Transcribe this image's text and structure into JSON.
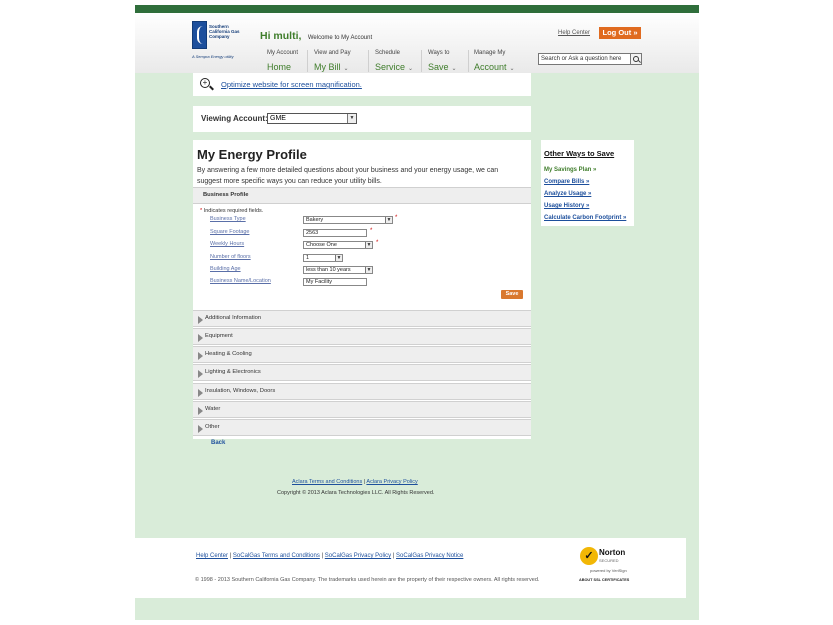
{
  "colors": {
    "brand_green": "#2f6e3b",
    "page_bg": "#d9ecd9",
    "link_blue": "#1d4f9c",
    "logout_orange": "#e06b20"
  },
  "logo": {
    "name": "Southern California Gas Company",
    "tagline": "A Sempra Energy utility"
  },
  "header": {
    "greeting": "Hi multi,",
    "welcome": "Welcome to My Account",
    "help_center": "Help Center",
    "logout": "Log Out »",
    "search_placeholder": "Search or Ask a question here",
    "nav": [
      {
        "small": "My Account",
        "large": "Home"
      },
      {
        "small": "View and Pay",
        "large": "My Bill"
      },
      {
        "small": "Schedule",
        "large": "Service"
      },
      {
        "small": "Ways to",
        "large": "Save"
      },
      {
        "small": "Manage My",
        "large": "Account"
      }
    ]
  },
  "magnify": {
    "link": "Optimize website for screen magnification.",
    "icon": "magnifier-plus-icon"
  },
  "viewing": {
    "label": "Viewing Account:",
    "selected": "GME"
  },
  "profile": {
    "title": "My Energy Profile",
    "intro": "By answering a few more detailed questions about your business and your energy usage, we can suggest more specific ways you can reduce your utility bills.",
    "sections": [
      "Business Profile",
      "Additional Information",
      "Equipment",
      "Heating & Cooling",
      "Lighting & Electronics",
      "Insulation, Windows, Doors",
      "Water",
      "Other"
    ],
    "required_note": "Indicates required fields.",
    "required_mark": "*",
    "fields": [
      {
        "label": "Business Type",
        "value": "Bakery"
      },
      {
        "label": "Square Footage",
        "value": "2563"
      },
      {
        "label": "Weekly Hours",
        "value": "Choose One"
      },
      {
        "label": "Number of floors",
        "value": "1"
      },
      {
        "label": "Building Age",
        "value": "less than 10 years"
      },
      {
        "label": "Business Name/Location",
        "value": "My Facility"
      }
    ],
    "save": "Save"
  },
  "back": "Back",
  "terms": {
    "terms": "Aclara Terms and Conditions",
    "privacy": "Aclara Privacy Policy",
    "copyright": "Copyright © 2013 Aclara Technologies LLC. All Rights Reserved."
  },
  "side": {
    "title": "Other Ways to Save",
    "items": [
      "My Savings Plan »",
      "Compare Bills »",
      "Analyze Usage »",
      "Usage History »",
      "Calculate Carbon Footprint »"
    ]
  },
  "footer": {
    "links": [
      "Help Center",
      "SoCalGas Terms and Conditions",
      "SoCalGas Privacy Policy",
      "SoCalGas Privacy Notice"
    ],
    "copyright": "© 1998 - 2013 Southern California Gas Company. The trademarks used herein are the property of their respective owners. All rights reserved.",
    "norton": {
      "name": "Norton",
      "secured": "SECURED",
      "powered": "powered by VeriSign",
      "about": "ABOUT SSL CERTIFICATES"
    }
  }
}
